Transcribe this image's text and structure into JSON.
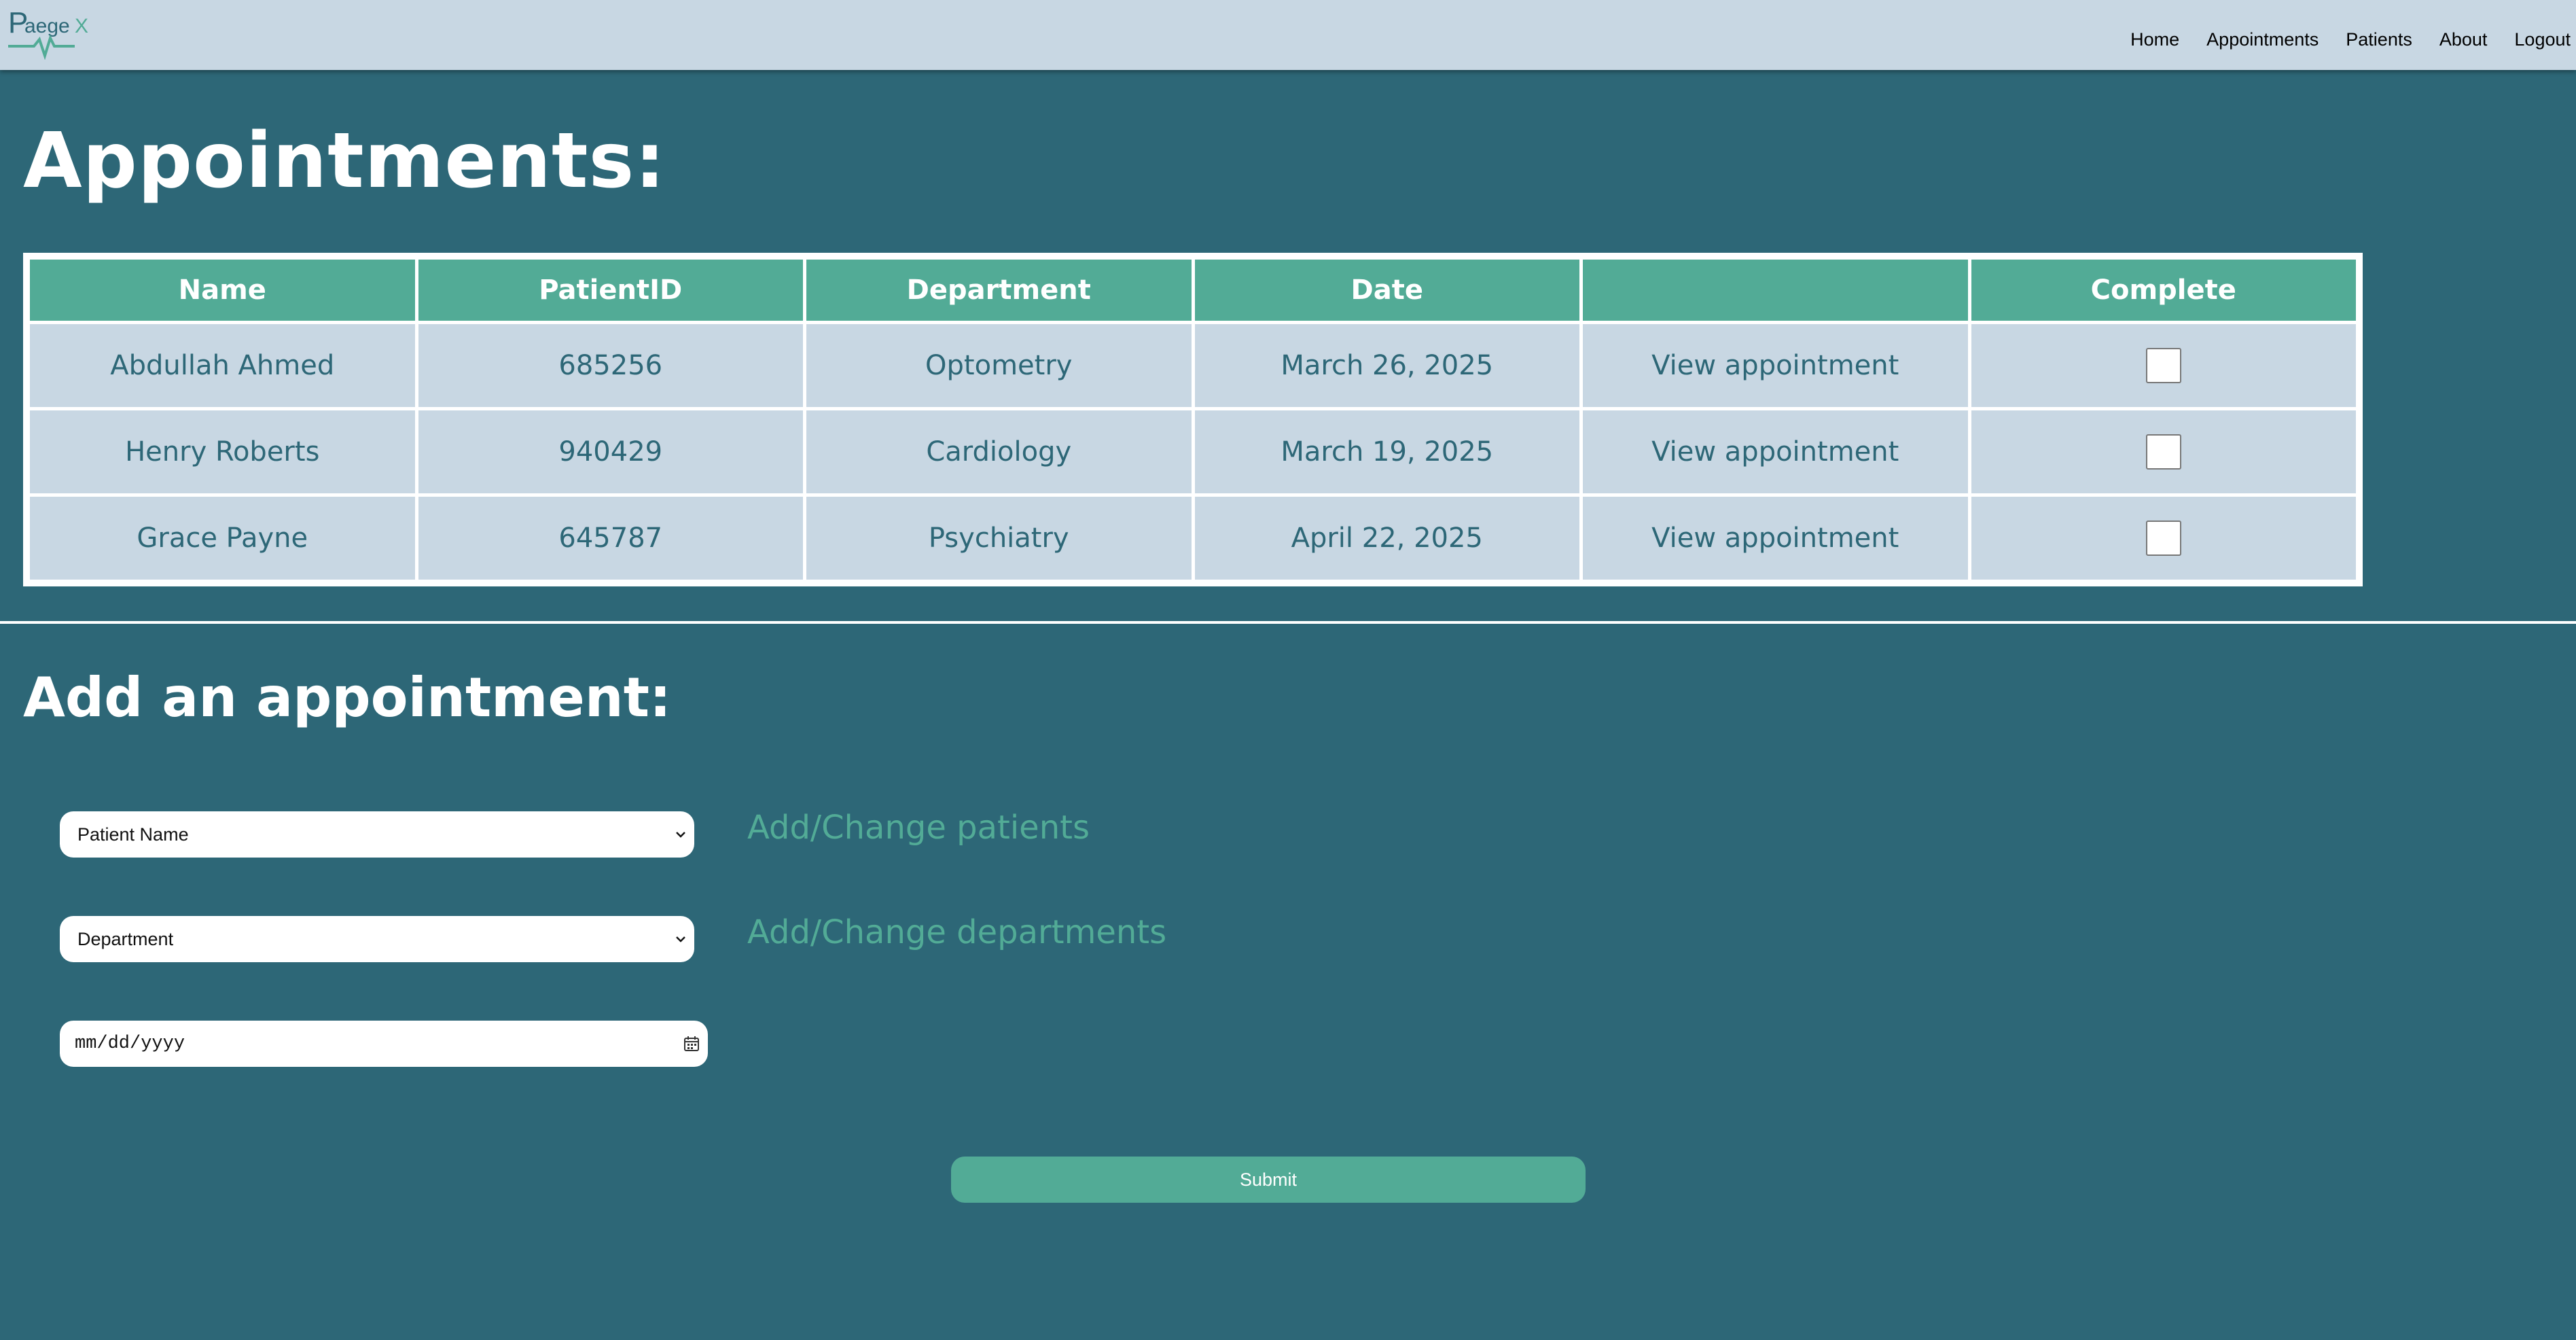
{
  "brand": {
    "logo_text": "PaegeX",
    "colors": {
      "primary": "#2d6777",
      "accent": "#52ab96",
      "light": "#c8d7e3"
    }
  },
  "nav": {
    "items": [
      {
        "label": "Home"
      },
      {
        "label": "Appointments"
      },
      {
        "label": "Patients"
      },
      {
        "label": "About"
      },
      {
        "label": "Logout"
      }
    ]
  },
  "page": {
    "title": "Appointments:"
  },
  "table": {
    "headers": [
      "Name",
      "PatientID",
      "Department",
      "Date",
      "",
      "Complete"
    ],
    "rows": [
      {
        "name": "Abdullah Ahmed",
        "patient_id": "685256",
        "department": "Optometry",
        "date": "March 26, 2025",
        "action": "View appointment",
        "complete": false
      },
      {
        "name": "Henry Roberts",
        "patient_id": "940429",
        "department": "Cardiology",
        "date": "March 19, 2025",
        "action": "View appointment",
        "complete": false
      },
      {
        "name": "Grace Payne",
        "patient_id": "645787",
        "department": "Psychiatry",
        "date": "April 22, 2025",
        "action": "View appointment",
        "complete": false
      }
    ]
  },
  "form": {
    "title": "Add an appointment:",
    "patient_select": "Patient Name",
    "department_select": "Department",
    "date_placeholder": "mm/dd/yyyy",
    "add_patients_link": "Add/Change patients",
    "add_departments_link": "Add/Change departments",
    "submit_label": "Submit"
  }
}
